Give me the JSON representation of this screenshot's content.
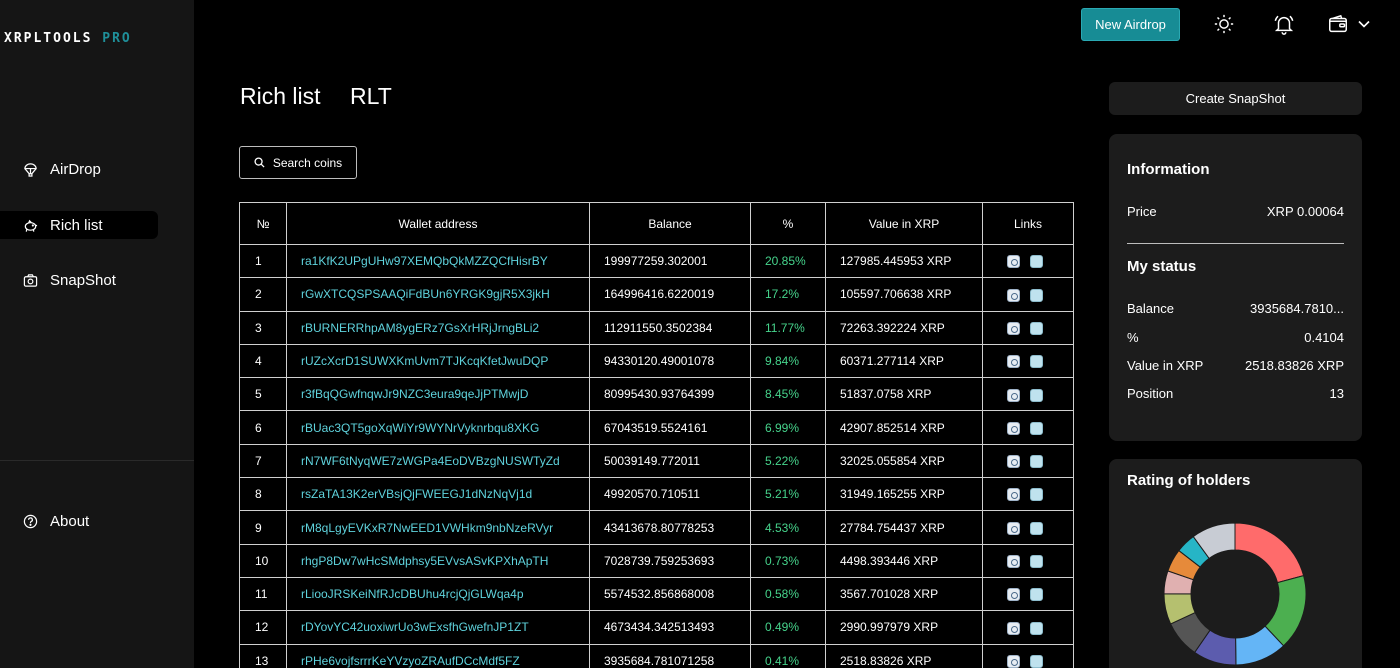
{
  "app": {
    "logo_main": "XRPLTOOLS",
    "logo_pro": "PRO"
  },
  "sidebar": {
    "items": [
      {
        "label": "AirDrop",
        "icon": "parachute-icon"
      },
      {
        "label": "Rich list",
        "icon": "piggy-bank-icon"
      },
      {
        "label": "SnapShot",
        "icon": "camera-icon"
      }
    ],
    "about": {
      "label": "About",
      "icon": "help-circle-icon"
    }
  },
  "topbar": {
    "new_airdrop": "New Airdrop",
    "icons": [
      "sun-icon",
      "bell-icon",
      "wallet-icon",
      "chevron-down-icon"
    ]
  },
  "main": {
    "tabs": [
      "Rich list",
      "RLT"
    ],
    "search_label": "Search coins",
    "table": {
      "columns": [
        "№",
        "Wallet address",
        "Balance",
        "%",
        "Value in XRP",
        "Links"
      ],
      "rows": [
        {
          "n": "1",
          "address": "ra1KfK2UPgUHw97XEMQbQkMZZQCfHisrBY",
          "balance": "199977259.302001",
          "pct": "20.85%",
          "value": "127985.445953 XRP"
        },
        {
          "n": "2",
          "address": "rGwXTCQSPSAAQiFdBUn6YRGK9gjR5X3jkH",
          "balance": "164996416.6220019",
          "pct": "17.2%",
          "value": "105597.706638 XRP"
        },
        {
          "n": "3",
          "address": "rBURNERRhpAM8ygERz7GsXrHRjJrngBLi2",
          "balance": "112911550.3502384",
          "pct": "11.77%",
          "value": "72263.392224 XRP"
        },
        {
          "n": "4",
          "address": "rUZcXcrD1SUWXKmUvm7TJKcqKfetJwuDQP",
          "balance": "94330120.49001078",
          "pct": "9.84%",
          "value": "60371.277114 XRP"
        },
        {
          "n": "5",
          "address": "r3fBqQGwfnqwJr9NZC3eura9qeJjPTMwjD",
          "balance": "80995430.93764399",
          "pct": "8.45%",
          "value": "51837.0758 XRP"
        },
        {
          "n": "6",
          "address": "rBUac3QT5goXqWiYr9WYNrVyknrbqu8XKG",
          "balance": "67043519.5524161",
          "pct": "6.99%",
          "value": "42907.852514 XRP"
        },
        {
          "n": "7",
          "address": "rN7WF6tNyqWE7zWGPa4EoDVBzgNUSWTyZd",
          "balance": "50039149.772011",
          "pct": "5.22%",
          "value": "32025.055854 XRP"
        },
        {
          "n": "8",
          "address": "rsZaTA13K2erVBsjQjFWEEGJ1dNzNqVj1d",
          "balance": "49920570.710511",
          "pct": "5.21%",
          "value": "31949.165255 XRP"
        },
        {
          "n": "9",
          "address": "rM8qLgyEVKxR7NwEED1VWHkm9nbNzeRVyr",
          "balance": "43413678.80778253",
          "pct": "4.53%",
          "value": "27784.754437 XRP"
        },
        {
          "n": "10",
          "address": "rhgP8Dw7wHcSMdphsy5EVvsASvKPXhApTH",
          "balance": "7028739.759253693",
          "pct": "0.73%",
          "value": "4498.393446 XRP"
        },
        {
          "n": "11",
          "address": "rLiooJRSKeiNfRJcDBUhu4rcjQjGLWqa4p",
          "balance": "5574532.856868008",
          "pct": "0.58%",
          "value": "3567.701028 XRP"
        },
        {
          "n": "12",
          "address": "rDYovYC42uoxiwrUo3wExsfhGwefnJP1ZT",
          "balance": "4673434.342513493",
          "pct": "0.49%",
          "value": "2990.997979 XRP"
        },
        {
          "n": "13",
          "address": "rPHe6vojfsrrrKeYVzyoZRAufDCcMdf5FZ",
          "balance": "3935684.781071258",
          "pct": "0.41%",
          "value": "2518.83826 XRP"
        }
      ]
    }
  },
  "right": {
    "create_snapshot": "Create SnapShot",
    "information": {
      "title": "Information",
      "price_label": "Price",
      "price_value": "XRP 0.00064"
    },
    "my_status": {
      "title": "My status",
      "rows": [
        {
          "label": "Balance",
          "value": "3935684.7810..."
        },
        {
          "label": "%",
          "value": "0.4104"
        },
        {
          "label": "Value in XRP",
          "value": "2518.83826 XRP"
        },
        {
          "label": "Position",
          "value": "13"
        }
      ]
    },
    "rating": {
      "title": "Rating of holders",
      "slices": [
        {
          "value": 20.85,
          "color": "#ff6b6b"
        },
        {
          "value": 17.2,
          "color": "#4caf50"
        },
        {
          "value": 11.77,
          "color": "#64b5f6"
        },
        {
          "value": 9.84,
          "color": "#5c5cae"
        },
        {
          "value": 8.45,
          "color": "#555555"
        },
        {
          "value": 6.99,
          "color": "#b5c06f"
        },
        {
          "value": 5.22,
          "color": "#e0b0b0"
        },
        {
          "value": 5.21,
          "color": "#e68a3a"
        },
        {
          "value": 4.53,
          "color": "#26b5c6"
        },
        {
          "value": 10.0,
          "color": "#c8ccd4"
        }
      ]
    }
  }
}
